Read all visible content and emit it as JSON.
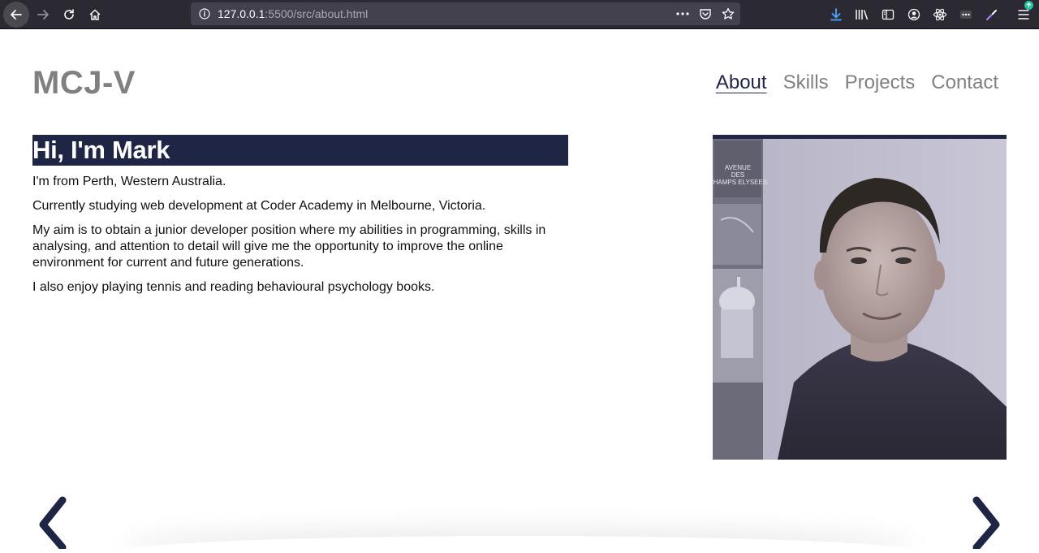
{
  "browser": {
    "url_host": "127.0.0.1",
    "url_path": ":5500/src/about.html"
  },
  "site": {
    "logo": "MCJ-V",
    "nav": [
      {
        "label": "About",
        "active": true
      },
      {
        "label": "Skills",
        "active": false
      },
      {
        "label": "Projects",
        "active": false
      },
      {
        "label": "Contact",
        "active": false
      }
    ]
  },
  "about": {
    "heading": "Hi, I'm Mark",
    "paragraphs": [
      "I'm from Perth, Western Australia.",
      "Currently studying web development at Coder Academy in Melbourne, Victoria.",
      "My aim is to obtain a junior developer position where my abilities in programming, skills in analysing, and attention to detail will give me the opportunity to improve the online environment for current and future generations.",
      "I also enjoy playing tennis and reading behavioural psychology books."
    ],
    "photo_sign_text": "AVENUE DES CHAMPS ELYSEES"
  },
  "colors": {
    "accent": "#1f2544",
    "muted": "#808080"
  },
  "icons": {
    "prev": "chevron-left-icon",
    "next": "chevron-right-icon"
  }
}
